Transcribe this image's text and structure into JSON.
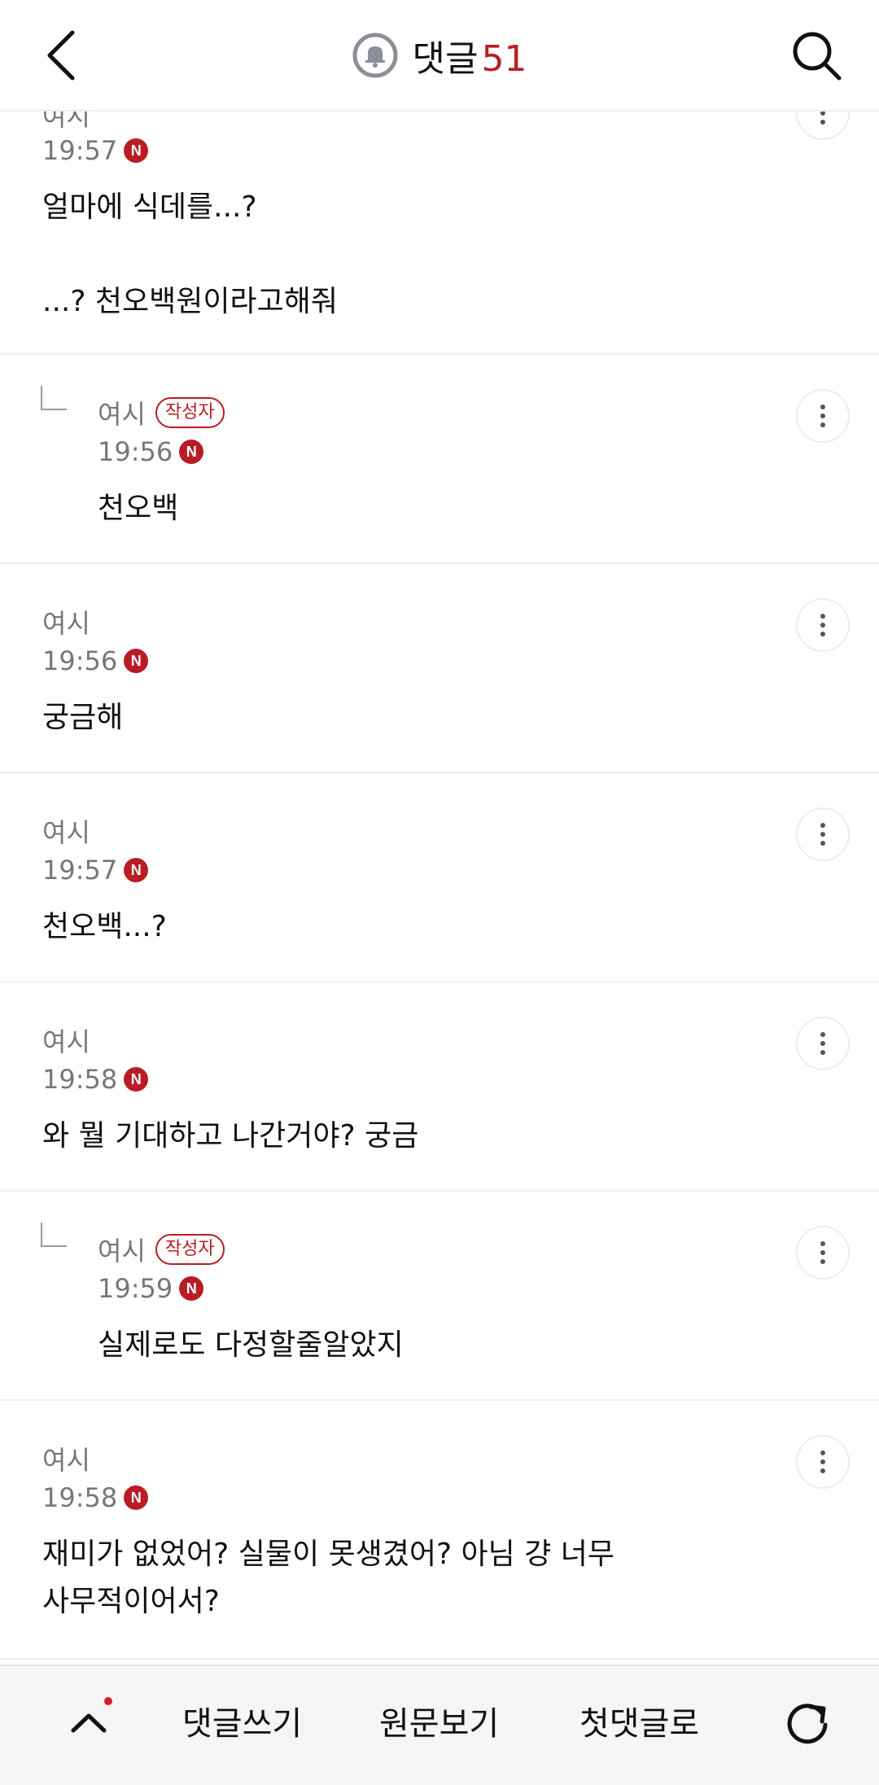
{
  "header": {
    "title": "댓글",
    "count": "51"
  },
  "comments": [
    {
      "author": "여시",
      "time": "19:57",
      "new_badge": "N",
      "text": "얼마에 식데를...?\n\n...? 천오백원이라고해줘"
    },
    {
      "author": "여시",
      "badge": "작성자",
      "time": "19:56",
      "new_badge": "N",
      "text": "천오백"
    },
    {
      "author": "여시",
      "time": "19:56",
      "new_badge": "N",
      "text": "궁금해"
    },
    {
      "author": "여시",
      "time": "19:57",
      "new_badge": "N",
      "text": "천오백...?"
    },
    {
      "author": "여시",
      "time": "19:58",
      "new_badge": "N",
      "text": "와 뭘 기대하고 나간거야? 궁금"
    },
    {
      "author": "여시",
      "badge": "작성자",
      "time": "19:59",
      "new_badge": "N",
      "text": "실제로도 다정할줄알았지"
    },
    {
      "author": "여시",
      "time": "19:58",
      "new_badge": "N",
      "text": "재미가 없었어? 실물이 못생겼어? 아님 걍 너무\n사무적이어서?"
    }
  ],
  "bottom_bar": {
    "write": "댓글쓰기",
    "original": "원문보기",
    "first": "첫댓글로"
  }
}
